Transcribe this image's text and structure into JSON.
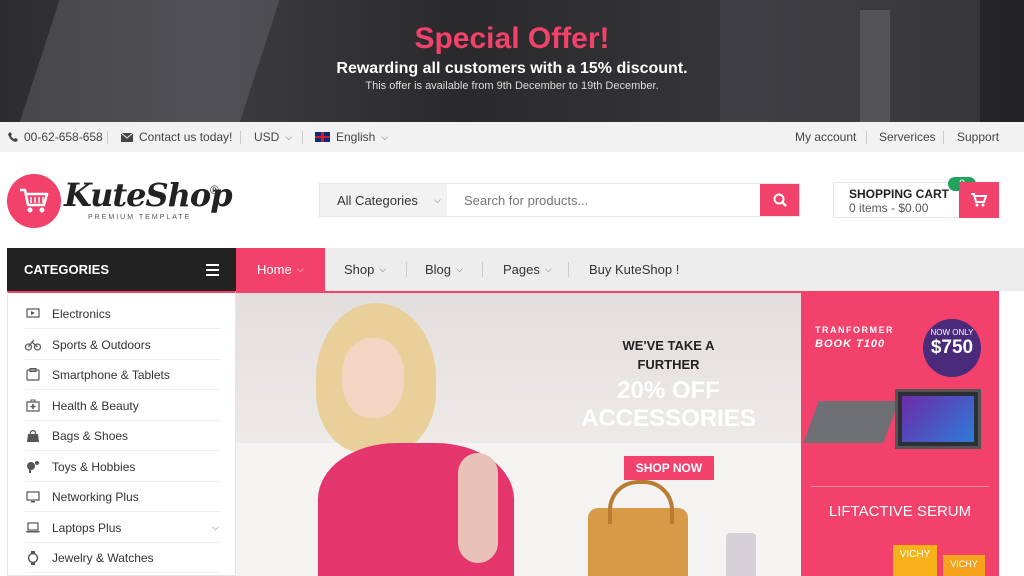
{
  "promo": {
    "title": "Special Offer!",
    "subtitle": "Rewarding all customers with a 15% discount.",
    "note": "This offer is available from 9th December to 19th December."
  },
  "utility": {
    "phone": "00-62-658-658",
    "contact": "Contact us today!",
    "currency": "USD",
    "language": "English",
    "links": [
      "My account",
      "Serverices",
      "Support"
    ]
  },
  "logo": {
    "name": "KuteShop",
    "reg": "®",
    "tagline": "PREMIUM TEMPLATE"
  },
  "search": {
    "category": "All Categories",
    "placeholder": "Search for products..."
  },
  "cart": {
    "label": "SHOPPING CART",
    "summary": "0 items - $0.00",
    "count": "0"
  },
  "categories": {
    "title": "CATEGORIES",
    "items": [
      {
        "label": "Electronics",
        "icon": "monitor-icon"
      },
      {
        "label": "Sports & Outdoors",
        "icon": "bike-icon"
      },
      {
        "label": "Smartphone & Tablets",
        "icon": "phone-icon"
      },
      {
        "label": "Health & Beauty",
        "icon": "medkit-icon"
      },
      {
        "label": "Bags & Shoes",
        "icon": "bag-icon"
      },
      {
        "label": "Toys & Hobbies",
        "icon": "toy-icon"
      },
      {
        "label": "Networking Plus",
        "icon": "network-icon"
      },
      {
        "label": "Laptops Plus",
        "icon": "laptop-icon"
      },
      {
        "label": "Jewelry & Watches",
        "icon": "watch-icon"
      }
    ]
  },
  "nav": {
    "items": [
      "Home",
      "Shop",
      "Blog",
      "Pages",
      "Buy KuteShop !"
    ]
  },
  "hero": {
    "line1": "WE'VE TAKE A",
    "line2": "FURTHER",
    "line3": "20% OFF",
    "line4": "ACCESSORIES",
    "button": "SHOP NOW"
  },
  "side_promo": {
    "brand_line1": "TRANFORMER",
    "brand_line2": "BOOK T100",
    "price_label": "NOW ONLY",
    "price": "$750",
    "serum": "LIFTACTIVE SERUM",
    "product_label": "VICHY"
  },
  "colors": {
    "accent": "#f2416b",
    "dark": "#222222",
    "badge": "#1fa35a"
  }
}
